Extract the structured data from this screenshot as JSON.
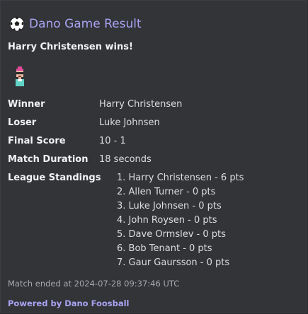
{
  "embed": {
    "title": "Dano Game Result",
    "description": "Harry Christensen wins!",
    "fields": [
      {
        "label": "Winner",
        "value": "Harry Christensen"
      },
      {
        "label": "Loser",
        "value": "Luke Johnsen"
      },
      {
        "label": "Final Score",
        "value": "10 - 1"
      },
      {
        "label": "Match Duration",
        "value": "18 seconds"
      }
    ],
    "standings": {
      "label": "League Standings",
      "items": [
        "1. Harry Christensen - 6 pts",
        "2. Allen Turner - 0 pts",
        "3. Luke Johnsen - 0 pts",
        "4. John Roysen - 0 pts",
        "5. Dave Ormslev - 0 pts",
        "6. Bob Tenant - 0 pts",
        "7. Gaur Gaursson - 0 pts"
      ]
    },
    "timestamp": "Match ended at 2024-07-28 09:37:46 UTC",
    "footer": "Powered by Dano Foosball"
  },
  "icons": {
    "title_icon": "soccer-ball-icon",
    "avatar": "pixel-avatar"
  },
  "colors": {
    "background": "#333438",
    "title": "#a9a3f2",
    "footer_link": "#a9a3f2"
  }
}
